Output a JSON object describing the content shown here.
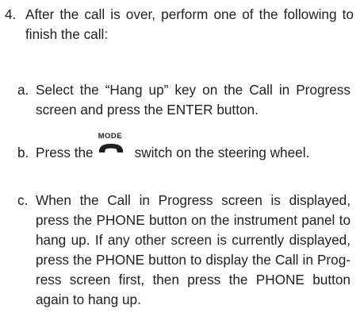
{
  "step": {
    "number": "4.",
    "text": "After the call is over, perform one of the following to finish the call:"
  },
  "options": [
    {
      "letter": "a.",
      "text": "Select the “Hang up” key on the Call in Progress screen and press the ENTER button."
    },
    {
      "letter": "b.",
      "text_before": "Press the",
      "icon_label": "MODE",
      "icon": "phone-hangup-icon",
      "text_after": "switch on the steering wheel."
    },
    {
      "letter": "c.",
      "text": "When the Call in Progress screen is dis­played, press the PHONE button on the instrument panel to hang up. If any other screen is currently displayed, press the PHONE button to display the Call in Prog­ress screen first, then press the PHONE button again to hang up."
    }
  ]
}
